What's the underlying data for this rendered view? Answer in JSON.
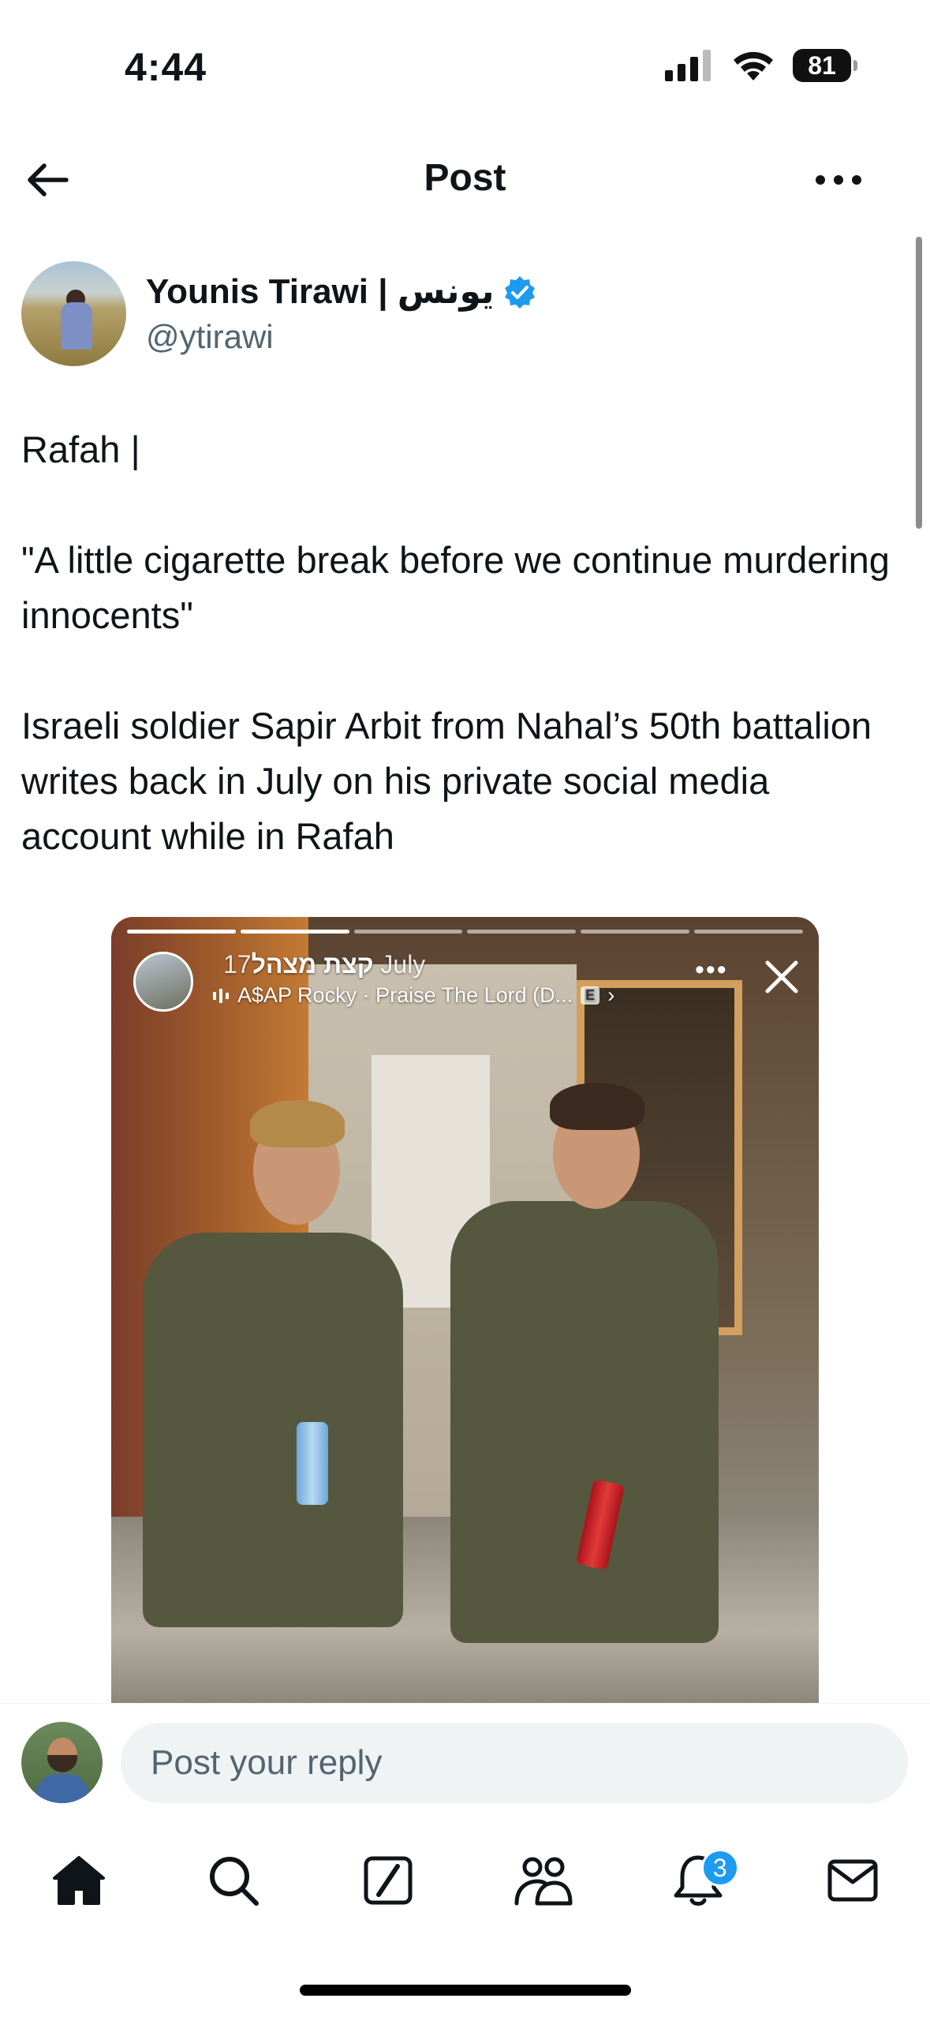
{
  "status_bar": {
    "time": "4:44",
    "battery": "81"
  },
  "header": {
    "title": "Post"
  },
  "author": {
    "name": "Younis Tirawi | يونس",
    "handle": "@ytirawi",
    "verified": true
  },
  "post": {
    "paragraphs": [
      "Rafah |",
      "\"A little cigarette break before we continue murdering innocents\"",
      "Israeli soldier Sapir Arbit from Nahal’s 50th battalion writes back in July on his private social media account while in Rafah"
    ]
  },
  "media": {
    "story_user": "קצת מצהל",
    "story_date": "17 July",
    "story_music": "A$AP Rocky · Praise The Lord (D...",
    "explicit_badge": "E"
  },
  "reply": {
    "placeholder": "Post your reply"
  },
  "tab_bar": {
    "items": [
      "home-icon",
      "search-icon",
      "grok-icon",
      "communities-icon",
      "notifications-icon",
      "messages-icon"
    ],
    "notification_count": "3"
  },
  "colors": {
    "accent": "#1d9bf0",
    "text": "#0f1419",
    "secondary": "#536471"
  }
}
